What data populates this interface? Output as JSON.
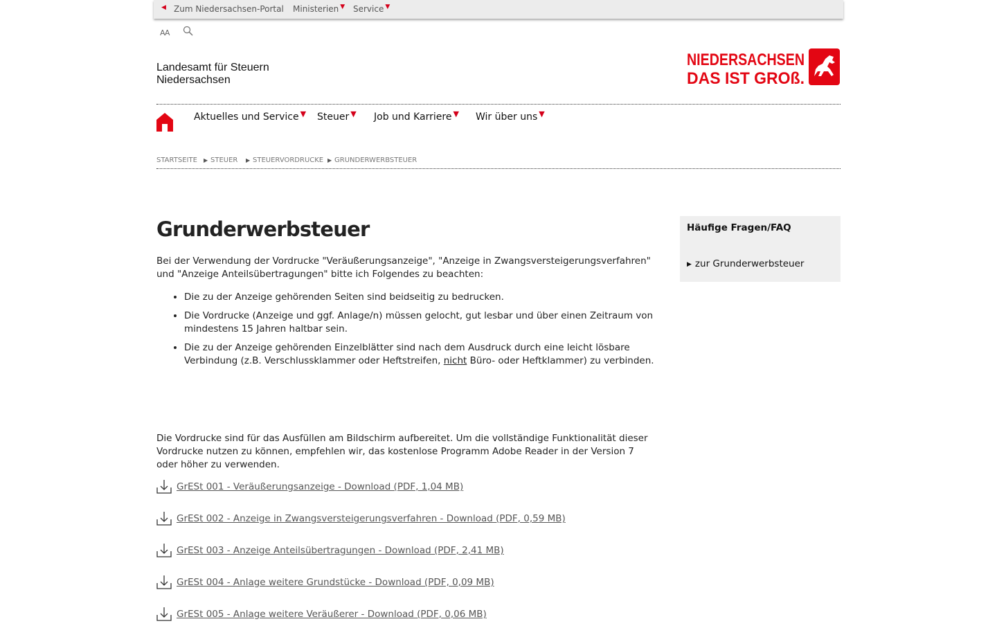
{
  "topbar": {
    "portal_link": "Zum Niedersachsen-Portal",
    "ministerien": "Ministerien",
    "service": "Service"
  },
  "tools": {
    "font_size_label": "AA"
  },
  "brand": {
    "line1": "Landesamt für Steuern",
    "line2": "Niedersachsen",
    "logo_line1": "NIEDERSACHSEN",
    "logo_line2": "DAS IST GROß."
  },
  "nav": {
    "items": [
      {
        "label": "Aktuelles und Service"
      },
      {
        "label": "Steuer"
      },
      {
        "label": "Job und Karriere"
      },
      {
        "label": "Wir über uns"
      }
    ]
  },
  "breadcrumb": [
    "Startseite",
    "Steuer",
    "Steuervordrucke",
    "Grunderwerbsteuer"
  ],
  "main": {
    "title": "Grunderwerbsteuer",
    "intro": "Bei der Verwendung der Vordrucke \"Veräußerungsanzeige\", \"Anzeige in Zwangsversteigerungsverfahren\" und \"Anzeige Anteilsübertragungen\" bitte ich Folgendes zu beachten:",
    "bullets": {
      "b1": "Die zu der Anzeige gehörenden Seiten sind beidseitig zu bedrucken.",
      "b2": "Die Vordrucke (Anzeige und ggf. Anlage/n) müssen gelocht, gut lesbar und über einen Zeitraum von mindestens 15 Jahren haltbar sein.",
      "b3_pre": "Die zu der Anzeige gehörenden Einzelblätter sind nach dem Ausdruck durch eine leicht lösbare Verbindung (z.B. Verschlussklammer oder Heftstreifen, ",
      "b3_under": "nicht",
      "b3_post": " Büro- oder Heftklammer) zu verbinden."
    },
    "note": "Die Vordrucke sind für das Ausfüllen am Bildschirm aufbereitet. Um die vollständige Funktionalität dieser Vordrucke nutzen zu können, empfehlen wir, das kostenlose Programm Adobe Reader in der Version 7 oder höher zu verwenden.",
    "downloads": [
      {
        "label": "GrESt 001 - Veräußerungsanzeige - Download (PDF, 1,04 MB)"
      },
      {
        "label": "GrESt 002 - Anzeige in Zwangsversteigerungsverfahren - Download (PDF, 0,59 MB)"
      },
      {
        "label": "GrESt 003 - Anzeige Anteilsübertragungen - Download (PDF, 2,41 MB)"
      },
      {
        "label": "GrESt 004 - Anlage weitere Grundstücke - Download (PDF, 0,09 MB)"
      },
      {
        "label": "GrESt 005 - Anlage weitere Veräußerer - Download (PDF, 0,06 MB)"
      }
    ]
  },
  "aside": {
    "title": "Häufige Fragen/FAQ",
    "link": "zur Grunderwerbsteuer"
  },
  "colors": {
    "accent": "#d4001a",
    "aside_bg": "#efefef",
    "topbar_bg": "#ececec"
  },
  "icons": [
    "arrow-left-icon",
    "caret-down-icon",
    "search-icon",
    "home-icon",
    "download-icon",
    "triangle-right-icon",
    "lower-saxony-horse-logo"
  ]
}
